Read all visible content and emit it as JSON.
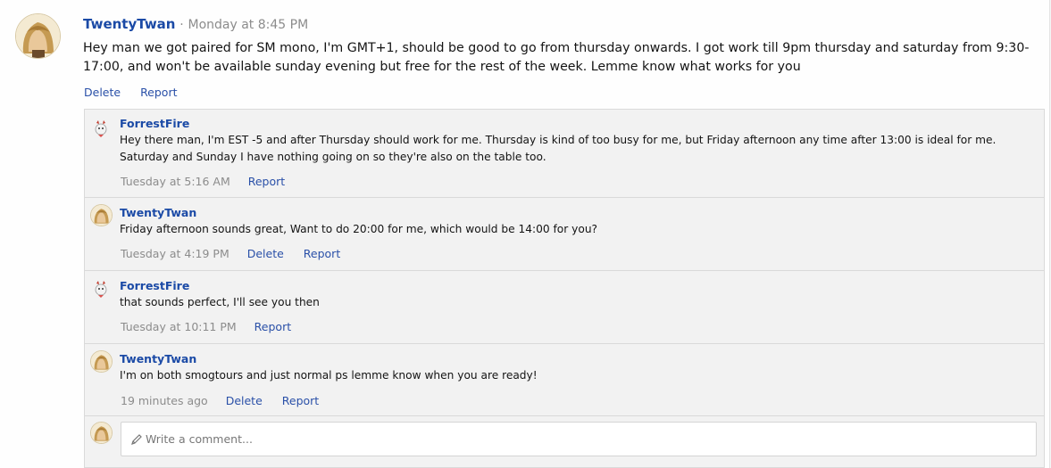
{
  "post": {
    "username": "TwentyTwan",
    "separator": "·",
    "time": "Monday at 8:45 PM",
    "body": "Hey man we got paired for SM mono, I'm GMT+1, should be good to go from thursday onwards. I got work till 9pm thursday and saturday from 9:30-17:00, and won't be available sunday evening but free for the rest of the week. Lemme know what works for you",
    "actions": {
      "delete": "Delete",
      "report": "Report"
    }
  },
  "comments": [
    {
      "username": "ForrestFire",
      "text": "Hey there man, I'm EST -5 and after Thursday should work for me. Thursday is kind of too busy for me, but Friday afternoon any time after 13:00 is ideal for me. Saturday and Sunday I have nothing going on so they're also on the table too.",
      "time": "Tuesday at 5:16 AM",
      "report": "Report"
    },
    {
      "username": "TwentyTwan",
      "text": "Friday afternoon sounds great, Want to do 20:00 for me, which would be 14:00 for you?",
      "time": "Tuesday at 4:19 PM",
      "delete": "Delete",
      "report": "Report"
    },
    {
      "username": "ForrestFire",
      "text": "that sounds perfect, I'll see you then",
      "time": "Tuesday at 10:11 PM",
      "report": "Report"
    },
    {
      "username": "TwentyTwan",
      "text": "I'm on both smogtours and just normal ps lemme know when you are ready!",
      "time": "19 minutes ago",
      "delete": "Delete",
      "report": "Report"
    }
  ],
  "new_comment": {
    "placeholder": "Write a comment..."
  },
  "icons": {
    "pencil": "pencil-icon",
    "avatar_twentytwan": "avatar",
    "avatar_forrestfire": "avatar"
  }
}
